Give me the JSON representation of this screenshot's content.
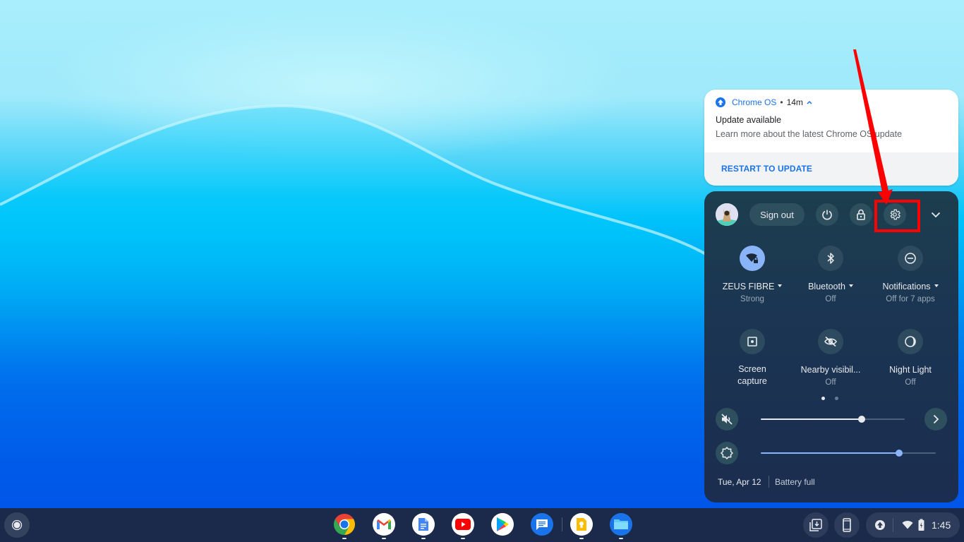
{
  "notification": {
    "app_name": "Chrome OS",
    "separator": "•",
    "time_ago": "14m",
    "title": "Update available",
    "message": "Learn more about the latest Chrome OS update",
    "action_label": "RESTART TO UPDATE"
  },
  "quick_settings": {
    "sign_out_label": "Sign out",
    "top_buttons": [
      "power",
      "lock",
      "settings",
      "collapse"
    ],
    "tiles": [
      {
        "label": "ZEUS FIBRE",
        "sub": "Strong",
        "has_menu": true,
        "active": true,
        "icon": "wifi-locked-icon"
      },
      {
        "label": "Bluetooth",
        "sub": "Off",
        "has_menu": true,
        "active": false,
        "icon": "bluetooth-icon"
      },
      {
        "label": "Notifications",
        "sub": "Off for 7 apps",
        "has_menu": true,
        "active": false,
        "icon": "do-not-disturb-icon"
      },
      {
        "label": "Screen",
        "label2": "capture",
        "sub": "",
        "has_menu": false,
        "active": false,
        "icon": "screen-capture-icon"
      },
      {
        "label": "Nearby visibil...",
        "sub": "Off",
        "has_menu": false,
        "active": false,
        "icon": "visibility-off-icon"
      },
      {
        "label": "Night Light",
        "sub": "Off",
        "has_menu": false,
        "active": false,
        "icon": "night-light-icon"
      }
    ],
    "page_count": 2,
    "current_page": 1,
    "volume": {
      "muted": true,
      "level_percent": 70
    },
    "brightness": {
      "level_percent": 79
    },
    "date": "Tue, Apr 12",
    "battery_status": "Battery full"
  },
  "shelf": {
    "apps": [
      {
        "name": "Chrome",
        "running": true
      },
      {
        "name": "Gmail",
        "running": true
      },
      {
        "name": "Google Docs",
        "running": true
      },
      {
        "name": "YouTube",
        "running": true
      },
      {
        "name": "Play Store",
        "running": false
      },
      {
        "name": "Messages",
        "running": false
      },
      {
        "name": "Google Keep",
        "running": true
      },
      {
        "name": "Files",
        "running": true
      }
    ],
    "clock": "1:45"
  },
  "colors": {
    "accent": "#1a73e8",
    "tile_active": "#8ab4f8",
    "annotation_red": "#ff0000"
  }
}
